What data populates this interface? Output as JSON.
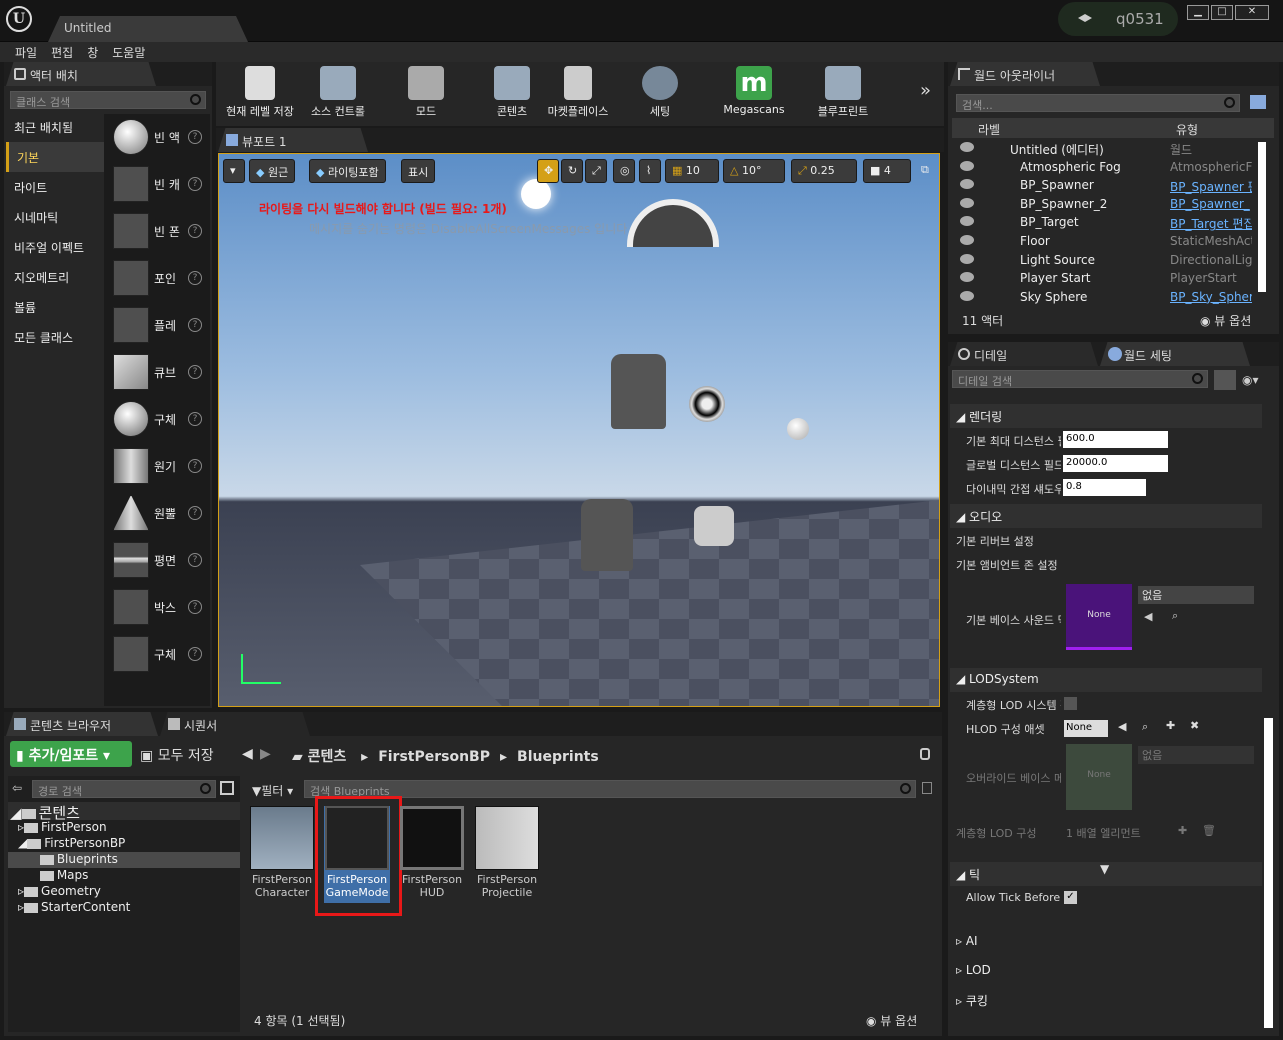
{
  "window": {
    "doc_tab": "Untitled",
    "user": "q0531",
    "min": "▁",
    "max": "□",
    "close": "✕"
  },
  "menu": [
    "파일",
    "편집",
    "창",
    "도움말"
  ],
  "modes": {
    "tab": "액터 배치",
    "search_placeholder": "클래스 검색",
    "categories": [
      "최근 배치됨",
      "기본",
      "라이트",
      "시네마틱",
      "비주얼 이펙트",
      "지오메트리",
      "볼륨",
      "모든 클래스"
    ],
    "actors": [
      "빈 액",
      "빈 캐",
      "빈 폰",
      "포인",
      "플레",
      "큐브",
      "구체",
      "원기",
      "원뿔",
      "평면",
      "박스",
      "구체"
    ]
  },
  "toolbar": {
    "buttons": [
      "현재 레벨 저장",
      "소스 컨트롤",
      "모드",
      "콘텐츠",
      "마켓플레이스",
      "세팅",
      "Megascans",
      "블루프린트"
    ]
  },
  "viewport": {
    "tab": "뷰포트 1",
    "btn_perspective": "원근",
    "btn_lit": "라이팅포함",
    "btn_show": "표시",
    "snap_grid": "10",
    "snap_rot": "10°",
    "snap_scale": "0.25",
    "cam_speed": "4",
    "warning": "라이팅을 다시 빌드해야 합니다 (빌드 필요: 1개)",
    "hint": "메시지를 숨기는 명령은 DisableAllScreenMessages 입니다"
  },
  "outliner": {
    "tab": "월드 아웃라이너",
    "search_placeholder": "검색...",
    "col_label": "라벨",
    "col_type": "유형",
    "rows": [
      {
        "name": "Untitled (에디터)",
        "type": "월드",
        "link": false
      },
      {
        "name": "Atmospheric Fog",
        "type": "AtmosphericFo",
        "link": false
      },
      {
        "name": "BP_Spawner",
        "type": "BP_Spawner 편",
        "link": true
      },
      {
        "name": "BP_Spawner_2",
        "type": "BP_Spawner_",
        "link": true
      },
      {
        "name": "BP_Target",
        "type": "BP_Target 편집",
        "link": true
      },
      {
        "name": "Floor",
        "type": "StaticMeshActo",
        "link": false
      },
      {
        "name": "Light Source",
        "type": "DirectionalLigh",
        "link": false
      },
      {
        "name": "Player Start",
        "type": "PlayerStart",
        "link": false
      },
      {
        "name": "Sky Sphere",
        "type": "BP_Sky_Sphere",
        "link": true
      }
    ],
    "count": "11 액터",
    "view_options": "뷰 옵션"
  },
  "details": {
    "tab_details": "디테일",
    "tab_world": "월드 세팅",
    "search_placeholder": "디테일 검색",
    "sec_rendering": "렌더링",
    "rendering": [
      {
        "label": "기본 최대 디스턴스 필",
        "value": "600.0"
      },
      {
        "label": "글로벌 디스턴스 필드",
        "value": "20000.0"
      },
      {
        "label": "다이내믹 간접 섀도우",
        "value": "0.8"
      }
    ],
    "sec_audio": "오디오",
    "audio_reverb": "기본 리버브 설정",
    "audio_ambient": "기본 앰비언트 존 설정",
    "audio_base_sound": "기본 베이스 사운드 믹",
    "none": "None",
    "none_kr": "없음",
    "sec_lod": "LODSystem",
    "lod_hier": "계층형 LOD 시스템 활",
    "lod_hlod": "HLOD 구성 애셋",
    "lod_override": "오버라이드 베이스 메",
    "lod_setup": "계층형 LOD 구성",
    "lod_setup_val": "1 배열 엘리먼트",
    "sec_tick": "틱",
    "tick_allow": "Allow Tick Before Begin Play",
    "sec_ai": "AI",
    "sec_lod2": "LOD",
    "sec_cook": "쿠킹"
  },
  "content": {
    "tab_browser": "콘텐츠 브라우저",
    "tab_sequencer": "시퀀서",
    "add_import": "추가/임포트",
    "save_all": "모두 저장",
    "path": [
      "콘텐츠",
      "FirstPersonBP",
      "Blueprints"
    ],
    "path_search": "경로 검색",
    "filter": "필터",
    "asset_search": "검색 Blueprints",
    "tree": [
      {
        "name": "콘텐츠",
        "level": 0
      },
      {
        "name": "FirstPerson",
        "level": 1
      },
      {
        "name": "FirstPersonBP",
        "level": 1
      },
      {
        "name": "Blueprints",
        "level": 2
      },
      {
        "name": "Maps",
        "level": 2
      },
      {
        "name": "Geometry",
        "level": 1
      },
      {
        "name": "StarterContent",
        "level": 1
      }
    ],
    "assets": [
      {
        "name1": "FirstPerson",
        "name2": "Character"
      },
      {
        "name1": "FirstPerson",
        "name2": "GameMode"
      },
      {
        "name1": "FirstPerson",
        "name2": "HUD"
      },
      {
        "name1": "FirstPerson",
        "name2": "Projectile"
      }
    ],
    "status": "4 항목 (1 선택됨)",
    "view_options": "뷰 옵션"
  },
  "colors": {
    "accent": "#d4a017",
    "link": "#6ab3ff",
    "highlight": "#e81818",
    "green": "#3da34b"
  }
}
